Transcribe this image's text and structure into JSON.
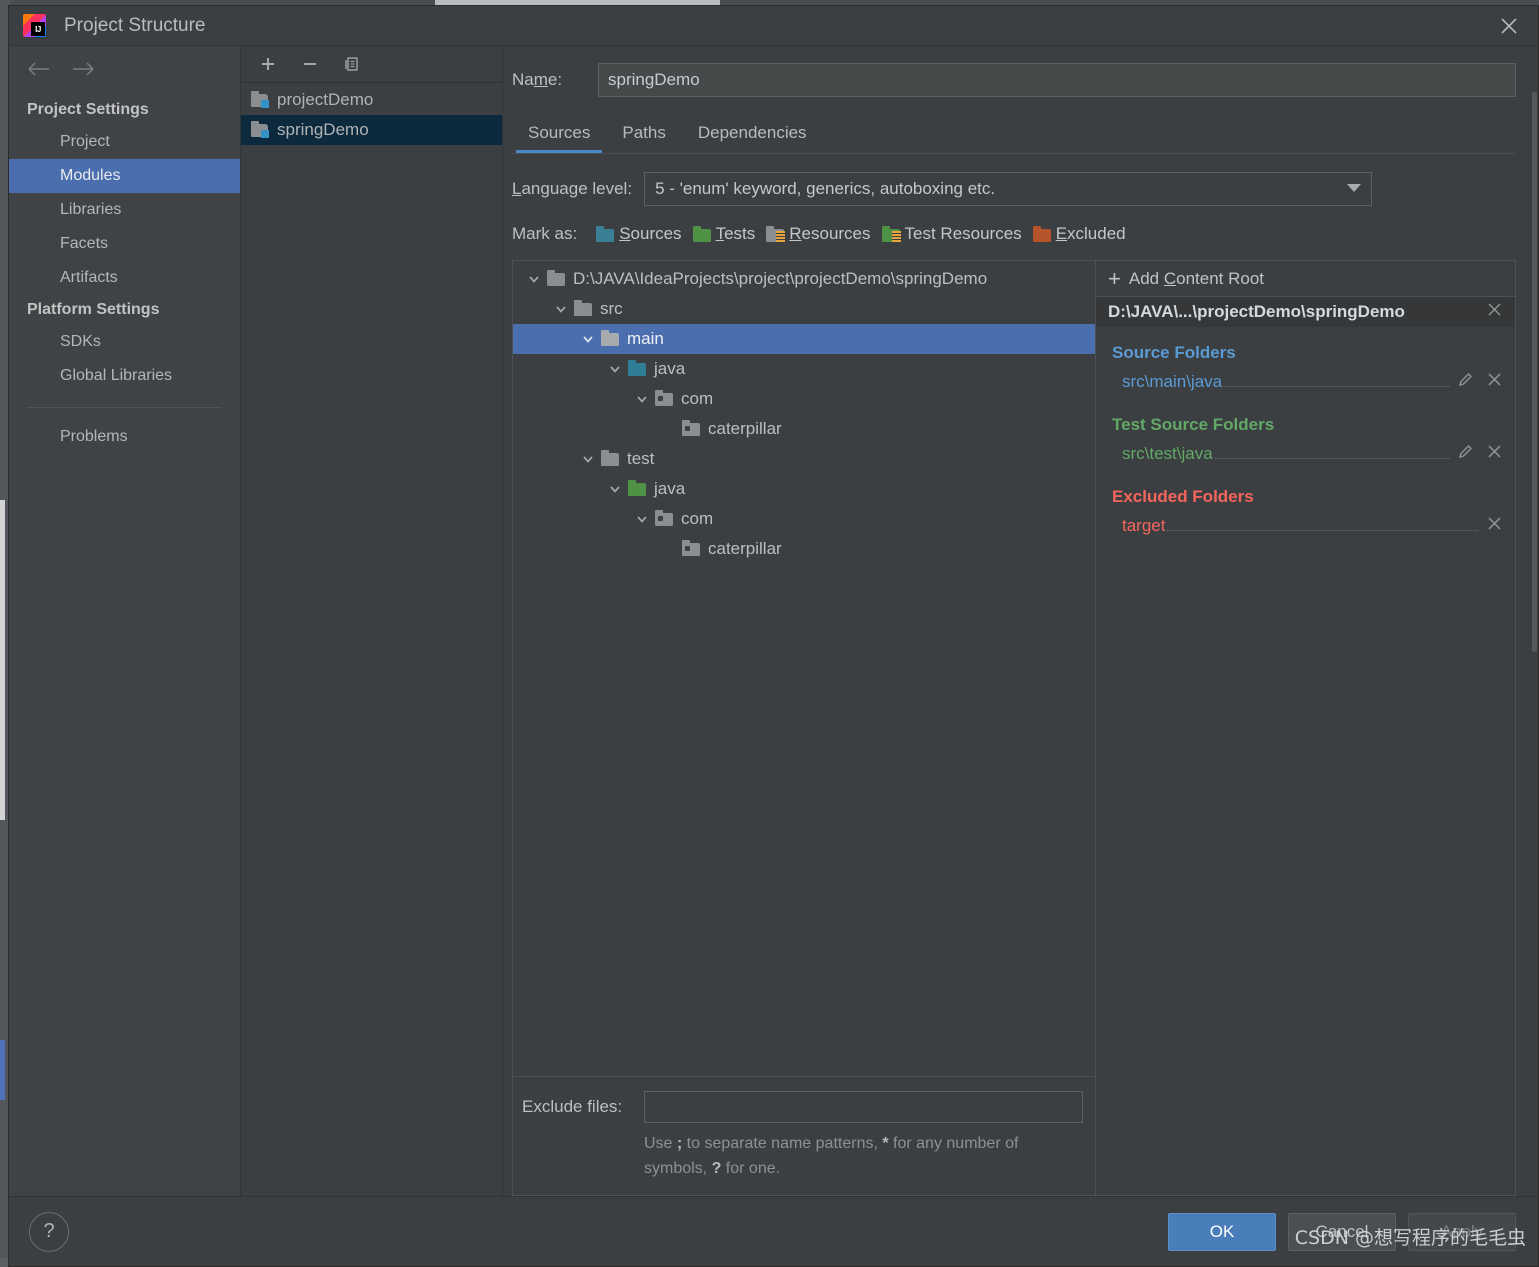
{
  "window": {
    "title": "Project Structure",
    "logo_text": "IJ",
    "close_icon": "close-icon"
  },
  "sidebar": {
    "back_icon": "arrow-left-icon",
    "forward_icon": "arrow-right-icon",
    "groups": [
      {
        "label": "Project Settings",
        "items": [
          {
            "label": "Project",
            "selected": false
          },
          {
            "label": "Modules",
            "selected": true
          },
          {
            "label": "Libraries",
            "selected": false
          },
          {
            "label": "Facets",
            "selected": false
          },
          {
            "label": "Artifacts",
            "selected": false
          }
        ]
      },
      {
        "label": "Platform Settings",
        "items": [
          {
            "label": "SDKs",
            "selected": false
          },
          {
            "label": "Global Libraries",
            "selected": false
          }
        ]
      }
    ],
    "problems_label": "Problems"
  },
  "modules_panel": {
    "toolbar": {
      "add_icon": "plus-icon",
      "remove_icon": "minus-icon",
      "copy_icon": "copy-icon"
    },
    "items": [
      {
        "label": "projectDemo",
        "selected": false
      },
      {
        "label": "springDemo",
        "selected": true
      }
    ]
  },
  "main": {
    "name_label": "Name:",
    "name_value": "springDemo",
    "tabs": [
      {
        "label": "Sources",
        "active": true
      },
      {
        "label": "Paths",
        "active": false
      },
      {
        "label": "Dependencies",
        "active": false
      }
    ],
    "language_level_label": "Language level:",
    "language_level_value": "5 - 'enum' keyword, generics, autoboxing etc.",
    "mark_as_label": "Mark as:",
    "mark_as": [
      {
        "label": "Sources",
        "mnemonic": "S",
        "rest": "ources",
        "color": "#3a7f95",
        "icon": "folder-sources-icon",
        "style": "plain"
      },
      {
        "label": "Tests",
        "mnemonic": "T",
        "rest": "ests",
        "color": "#4f9246",
        "icon": "folder-tests-icon",
        "style": "plain"
      },
      {
        "label": "Resources",
        "mnemonic": "R",
        "rest": "esources",
        "color": "#8b8e91",
        "icon": "folder-resources-icon",
        "style": "lines"
      },
      {
        "label": "Test Resources",
        "mnemonic": "",
        "rest": "Test Resources",
        "color": "#4f9246",
        "icon": "folder-test-resources-icon",
        "style": "mixed"
      },
      {
        "label": "Excluded",
        "mnemonic": "E",
        "rest": "xcluded",
        "color": "#b5542a",
        "icon": "folder-excluded-icon",
        "style": "plain"
      }
    ],
    "tree": [
      {
        "label": "D:\\JAVA\\IdeaProjects\\project\\projectDemo\\springDemo",
        "depth": 0,
        "expanded": true,
        "icon_color": "#8b8e91",
        "kind": "folder",
        "selected": false
      },
      {
        "label": "src",
        "depth": 1,
        "expanded": true,
        "icon_color": "#8b8e91",
        "kind": "folder",
        "selected": false
      },
      {
        "label": "main",
        "depth": 2,
        "expanded": true,
        "icon_color": "#a8abad",
        "kind": "folder",
        "selected": true
      },
      {
        "label": "java",
        "depth": 3,
        "expanded": true,
        "icon_color": "#2f7e96",
        "kind": "folder",
        "selected": false
      },
      {
        "label": "com",
        "depth": 4,
        "expanded": true,
        "icon_color": "#8b8e91",
        "kind": "package",
        "selected": false
      },
      {
        "label": "caterpillar",
        "depth": 5,
        "expanded": false,
        "icon_color": "#8b8e91",
        "kind": "package",
        "selected": false
      },
      {
        "label": "test",
        "depth": 2,
        "expanded": true,
        "icon_color": "#8b8e91",
        "kind": "folder",
        "selected": false
      },
      {
        "label": "java",
        "depth": 3,
        "expanded": true,
        "icon_color": "#4f9246",
        "kind": "folder",
        "selected": false
      },
      {
        "label": "com",
        "depth": 4,
        "expanded": true,
        "icon_color": "#8b8e91",
        "kind": "package",
        "selected": false
      },
      {
        "label": "caterpillar",
        "depth": 5,
        "expanded": false,
        "icon_color": "#8b8e91",
        "kind": "package",
        "selected": false
      }
    ],
    "exclude_files_label": "Exclude files:",
    "exclude_files_value": "",
    "exclude_hint_1": "Use ",
    "exclude_hint_semicolon": ";",
    "exclude_hint_2": " to separate name patterns, ",
    "exclude_hint_star": "*",
    "exclude_hint_3": " for any number of symbols, ",
    "exclude_hint_q": "?",
    "exclude_hint_4": " for one."
  },
  "roots_panel": {
    "add_content_root_prefix": "Add ",
    "add_content_root_mnemonic": "C",
    "add_content_root_rest": "ontent Root",
    "plus_icon": "plus-icon",
    "content_root_path": "D:\\JAVA\\...\\projectDemo\\springDemo",
    "sections": [
      {
        "title": "Source Folders",
        "kind": "src",
        "entries": [
          {
            "value": "src\\main\\java",
            "has_edit": true,
            "has_remove": true
          }
        ]
      },
      {
        "title": "Test Source Folders",
        "kind": "test",
        "entries": [
          {
            "value": "src\\test\\java",
            "has_edit": true,
            "has_remove": true
          }
        ]
      },
      {
        "title": "Excluded Folders",
        "kind": "exc",
        "entries": [
          {
            "value": "target",
            "has_edit": false,
            "has_remove": true
          }
        ]
      }
    ],
    "edit_icon": "pencil-icon",
    "remove_icon": "close-icon"
  },
  "footer": {
    "help_label": "?",
    "ok_label": "OK",
    "cancel_label": "Cancel",
    "apply_label": "Apply"
  },
  "watermark": "CSDN @想写程序的毛毛虫",
  "colors": {
    "accent": "#4b6eaf",
    "tab_underline": "#4a88c7",
    "source_blue": "#5b9bd5",
    "test_green": "#62a867",
    "excluded_red": "#f5655c",
    "ok_button": "#4a7ebb"
  }
}
